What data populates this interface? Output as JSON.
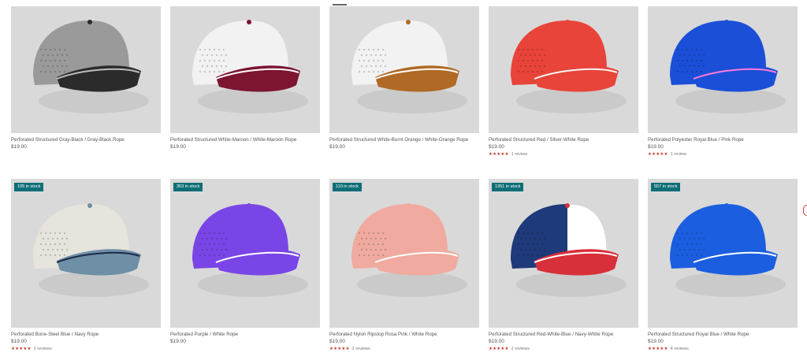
{
  "products": [
    {
      "title": "Perforated Structured Gray-Black / Gray-Black Rope",
      "price": "$19.00",
      "stock": "",
      "reviews": "",
      "stars": "",
      "crown": "#9a9a9a",
      "brim": "#2b2b2b",
      "rope": "#bdbdbd",
      "icon": "cap-icon"
    },
    {
      "title": "Perforated Structured White-Maroon / White-Maroon Rope",
      "price": "$19.00",
      "stock": "",
      "reviews": "",
      "stars": "",
      "crown": "#f2f2f2",
      "brim": "#7d1530",
      "rope": "#ffffff",
      "icon": "cap-icon"
    },
    {
      "title": "Perforated Structured White-Burnt Orange / White-Orange Rope",
      "price": "$19.00",
      "stock": "",
      "reviews": "",
      "stars": "",
      "crown": "#f2f2f2",
      "brim": "#b06a25",
      "rope": "#ffffff",
      "icon": "cap-icon"
    },
    {
      "title": "Perforated Structured Red / Silver-White Rope",
      "price": "$19.00",
      "stock": "",
      "reviews": "1 review",
      "stars": "★★★★★",
      "crown": "#e8443a",
      "brim": "#e8443a",
      "rope": "#f5f5f5",
      "icon": "cap-icon"
    },
    {
      "title": "Perforated Polyester Royal Blue / Pink Rope",
      "price": "$19.00",
      "stock": "",
      "reviews": "1 review",
      "stars": "★★★★★",
      "crown": "#1b4fd8",
      "brim": "#1b4fd8",
      "rope": "#ff7ad8",
      "icon": "cap-icon"
    },
    {
      "title": "Perforated Bone-Steel Blue / Navy Rope",
      "price": "$19.00",
      "stock": "105 in stock",
      "reviews": "2 reviews",
      "stars": "★★★★★",
      "crown": "#e6e4dc",
      "brim": "#6e8fa6",
      "rope": "#1b2a4a",
      "icon": "cap-icon"
    },
    {
      "title": "Perforated Purple / White Rope",
      "price": "$19.00",
      "stock": "353 in stock",
      "reviews": "",
      "stars": "",
      "crown": "#7a45e6",
      "brim": "#7a45e6",
      "rope": "#ffffff",
      "icon": "cap-icon"
    },
    {
      "title": "Perforated Nylon Ripstop Rosa Pink / White Rope",
      "price": "$19.00",
      "stock": "110 in stock",
      "reviews": "2 reviews",
      "stars": "★★★★★",
      "crown": "#f0aa9f",
      "brim": "#f0aa9f",
      "rope": "#ffffff",
      "icon": "cap-icon"
    },
    {
      "title": "Perforated Structured Red-White-Blue / Navy-White Rope",
      "price": "$19.00",
      "stock": "1351 in stock",
      "reviews": "2 reviews",
      "stars": "★★★★★",
      "crown": "#1f3a7a",
      "brim": "#d8303a",
      "rope": "#ffffff",
      "icon": "cap-icon"
    },
    {
      "title": "Perforated Structured Royal Blue / White Rope",
      "price": "$19.00",
      "stock": "557 in stock",
      "reviews": "4 reviews",
      "stars": "★★★★★",
      "crown": "#1b5fe0",
      "brim": "#1b5fe0",
      "rope": "#ffffff",
      "icon": "cap-icon"
    }
  ]
}
